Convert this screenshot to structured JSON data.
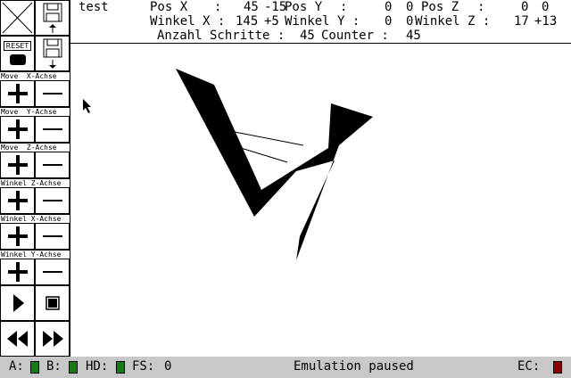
{
  "header": {
    "title": "test",
    "pos_x_label": "Pos X",
    "pos_x_sep": ":",
    "pos_x_value": "45",
    "pos_x_delta": "-15",
    "pos_y_label": "Pos Y",
    "pos_y_sep": ":",
    "pos_y_value": "0",
    "pos_y_delta": "0",
    "pos_z_label": "Pos Z",
    "pos_z_sep": ":",
    "pos_z_value": "0",
    "pos_z_delta": "0",
    "winkel_x_label": "Winkel X :",
    "winkel_x_value": "145",
    "winkel_x_delta": "+5",
    "winkel_y_label": "Winkel Y :",
    "winkel_y_value": "0",
    "winkel_y_delta": "0",
    "winkel_z_label": "Winkel Z :",
    "winkel_z_value": "17",
    "winkel_z_delta": "+13",
    "schritte_label": "Anzahl Schritte :",
    "schritte_value": "45",
    "counter_label": "Counter :",
    "counter_value": "45"
  },
  "toolbar": {
    "reset_label": "RESET",
    "groups": [
      {
        "label": "Move  X-Achse"
      },
      {
        "label": "Move  Y-Achse"
      },
      {
        "label": "Move  Z-Achse"
      },
      {
        "label": "Winkel Z-Achse"
      },
      {
        "label": "Winkel X-Achse"
      },
      {
        "label": "Winkel Y-Achse"
      }
    ]
  },
  "status": {
    "drive_a": "A:",
    "drive_b": "B:",
    "drive_hd": "HD:",
    "fs_label": "FS:",
    "fs_value": "0",
    "message": "Emulation paused",
    "ec_label": "EC:",
    "led_color": "#1a7a1a",
    "ec_led_color": "#8b0000",
    "bar_color": "#c8c8c8"
  },
  "icons": {
    "close": "close-icon",
    "save_up": "disk-upload-icon",
    "reset": "reset-icon",
    "save_down": "disk-download-icon",
    "plus": "plus-icon",
    "minus": "minus-icon",
    "play": "play-icon",
    "stop": "stop-icon",
    "rewind": "rewind-icon",
    "fast_forward": "fast-forward-icon",
    "cursor": "mouse-pointer-icon"
  }
}
